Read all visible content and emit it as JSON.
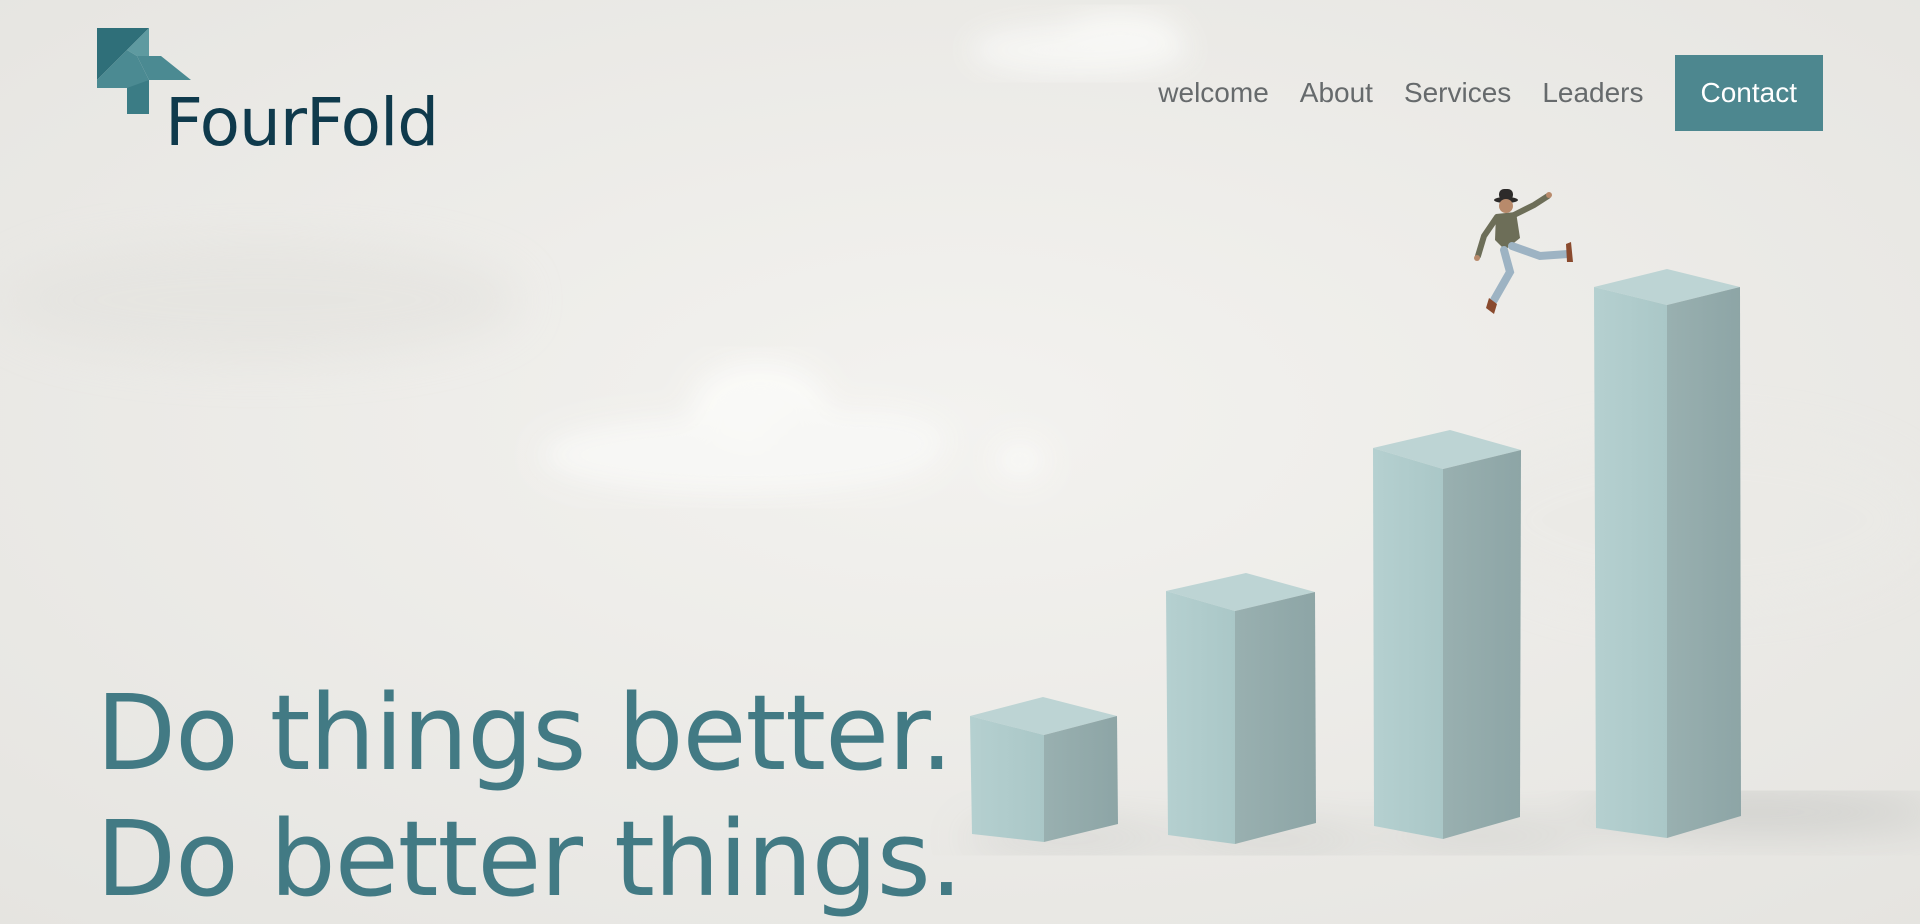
{
  "brand": {
    "name": "FourFold",
    "mark_color": "#4b8a92",
    "text_color": "#0f3a4c"
  },
  "nav": {
    "items": [
      {
        "label": "welcome"
      },
      {
        "label": "About"
      },
      {
        "label": "Services"
      },
      {
        "label": "Leaders"
      }
    ],
    "contact_label": "Contact",
    "contact_color": "#4d878f"
  },
  "hero": {
    "headline_line1": "Do things better.",
    "headline_line2": "Do better things.",
    "headline_color": "#427a84",
    "image": {
      "subject": "person-leaping-over-ascending-blocks",
      "block_color": "#a9c6c7",
      "background_color": "#eeedea"
    }
  }
}
